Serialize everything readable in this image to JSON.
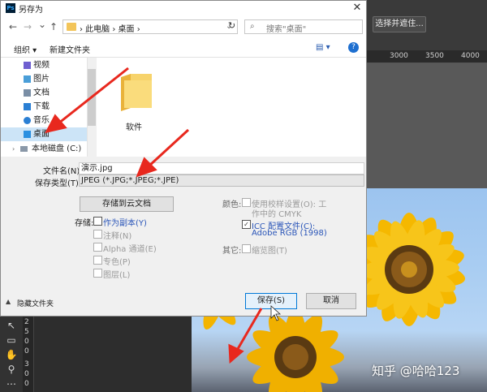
{
  "dialog": {
    "title": "另存为",
    "ps_logo": "Ps",
    "close_glyph": "✕"
  },
  "nav": {
    "back_glyph": "←",
    "forward_glyph": "→",
    "recent_glyph": "⌄",
    "up_glyph": "↑",
    "address_path": "› 此电脑 › 桌面 ›",
    "refresh_glyph": "↻",
    "search_placeholder": "搜索\"桌面\"",
    "search_glyph": "⌕"
  },
  "toolbar": {
    "organize": "组织 ▾",
    "new_folder": "新建文件夹",
    "view_glyph": "▤ ▾",
    "help_glyph": "?"
  },
  "sidebar": {
    "items": [
      {
        "label": "视频",
        "icon": "video-icon",
        "color": "#6f5fd0"
      },
      {
        "label": "图片",
        "icon": "pictures-icon",
        "color": "#4a9ed8"
      },
      {
        "label": "文档",
        "icon": "documents-icon",
        "color": "#7a8ea5"
      },
      {
        "label": "下载",
        "icon": "downloads-icon",
        "color": "#2a7fd4"
      },
      {
        "label": "音乐",
        "icon": "music-icon",
        "color": "#2a7fd4"
      },
      {
        "label": "桌面",
        "icon": "desktop-icon",
        "color": "#2a8fe0",
        "selected": true
      },
      {
        "label": "本地磁盘 (C:)",
        "icon": "drive-icon",
        "color": "#8a98a8"
      }
    ]
  },
  "files": {
    "items": [
      {
        "label": "软件",
        "icon": "folder-icon"
      }
    ]
  },
  "form": {
    "filename_label": "文件名(N):",
    "filename_value": "演示.jpg",
    "filetype_label": "保存类型(T):",
    "filetype_value": "JPEG (*.JPG;*.JPEG;*.JPE)"
  },
  "options": {
    "save_cloud": "存储到云文档",
    "storage_label": "存储:",
    "as_copy": "作为副本(Y)",
    "notes": "注释(N)",
    "alpha": "Alpha 通道(E)",
    "spot": "专色(P)",
    "layers": "图层(L)",
    "color_label": "颜色:",
    "proof_line1": "使用校样设置(O):  工",
    "proof_line2": "作中的 CMYK",
    "icc_line1": "ICC 配置文件(C):",
    "icc_line2": "Adobe RGB (1998)",
    "other_label": "其它:",
    "thumbnail": "缩览图(T)"
  },
  "footer": {
    "hide_folders": "隐藏文件夹",
    "save": "保存(S)",
    "cancel": "取消"
  },
  "photoshop": {
    "select_mask_btn": "选择并遮住...",
    "ruler_top": [
      "3000",
      "3500",
      "4000"
    ],
    "ruler_left": [
      "2",
      "5",
      "0",
      "0",
      "3",
      "0",
      "0"
    ],
    "watermark": "知乎 @哈哈123"
  },
  "colors": {
    "accent": "#0078d7",
    "arrow": "#e8281e",
    "selection": "#cce4f7"
  }
}
